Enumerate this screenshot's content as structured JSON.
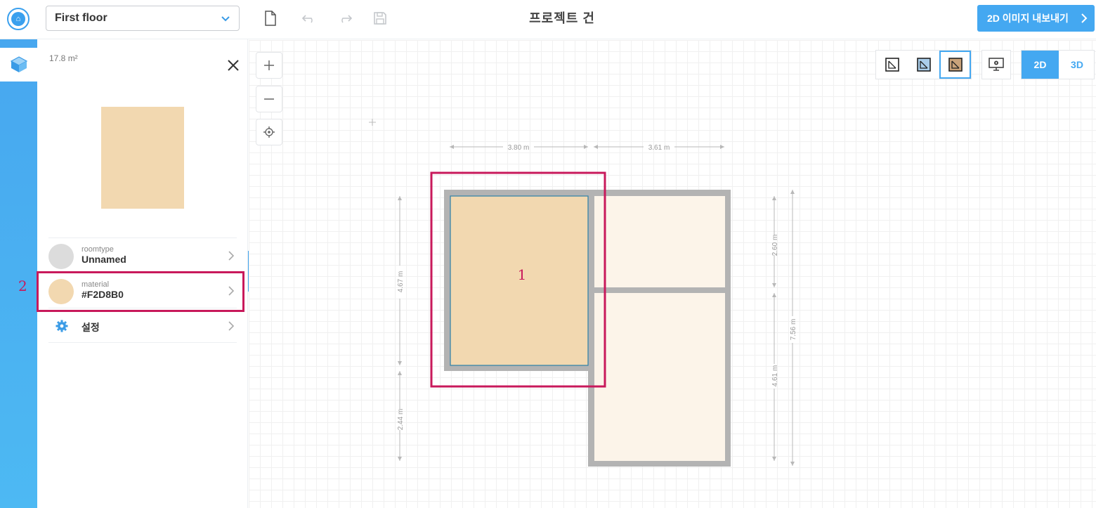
{
  "topbar": {
    "floor_value": "First floor",
    "project_title": "프로젝트 건",
    "export_label": "2D 이미지 내보내기"
  },
  "panel": {
    "area": "17.8 m²",
    "swatch_color": "#F2D8B0",
    "rows": [
      {
        "small": "roomtype",
        "big": "Unnamed"
      },
      {
        "small": "material",
        "big": "#F2D8B0"
      }
    ],
    "settings_label": "설정"
  },
  "view": {
    "toggle_2d": "2D",
    "toggle_3d": "3D"
  },
  "floorplan": {
    "dims": {
      "top_left": "3.80 m",
      "top_right": "3.61 m",
      "left_upper": "4.67 m",
      "left_lower": "2.44 m",
      "right_upper": "2.60 m",
      "right_lower": "4.61 m",
      "right_total": "7.56 m"
    },
    "room_label": "1"
  },
  "annotations": {
    "material_marker": "2"
  }
}
